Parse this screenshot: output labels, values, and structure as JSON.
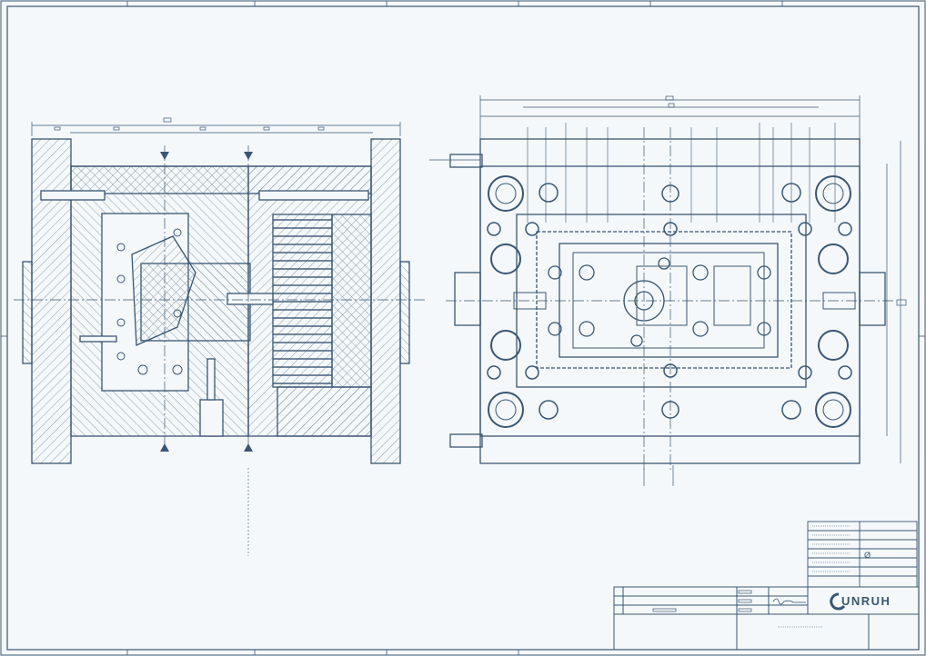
{
  "drawing": {
    "ink_color": "#3a5673",
    "paper_color": "#f5f8fa",
    "hatch_color": "#6f87a0",
    "symbol_diameter": "Ø"
  },
  "title_block": {
    "brand": "UNRUH",
    "logo_icon": "unruh-logo-icon"
  }
}
